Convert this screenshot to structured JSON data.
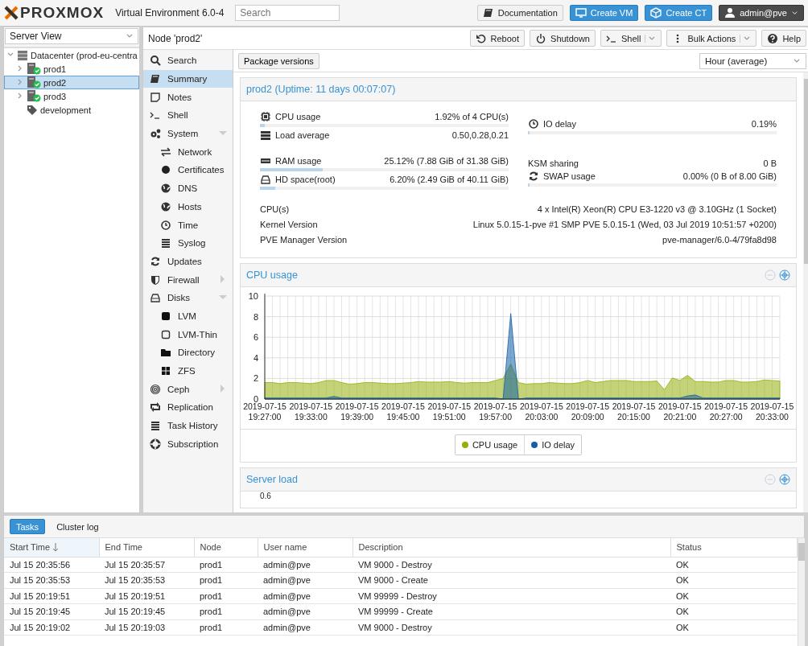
{
  "header": {
    "brand": "PROXMOX",
    "product": "Virtual Environment 6.0-4",
    "search": {
      "placeholder": "Search"
    },
    "buttons": [
      {
        "label": "Documentation",
        "kind": "plain"
      },
      {
        "label": "Create VM",
        "kind": "primary"
      },
      {
        "label": "Create CT",
        "kind": "primary"
      },
      {
        "label": "admin@pve",
        "kind": "user"
      }
    ]
  },
  "tree": {
    "view": "Server View",
    "items": [
      {
        "label": "Datacenter (prod-eu-centra",
        "kind": "datacenter",
        "expanded": true,
        "selected": false,
        "children": [
          {
            "label": "prod1",
            "kind": "node",
            "expanded": false,
            "selected": false
          },
          {
            "label": "prod2",
            "kind": "node",
            "expanded": false,
            "selected": true
          },
          {
            "label": "prod3",
            "kind": "node",
            "expanded": false,
            "selected": false
          },
          {
            "label": "development",
            "kind": "pool",
            "selected": false
          }
        ]
      }
    ]
  },
  "node_bar": {
    "title": "Node 'prod2'",
    "buttons": [
      {
        "label": "Reboot",
        "menu": false
      },
      {
        "label": "Shutdown",
        "menu": false
      },
      {
        "label": "Shell",
        "menu": true
      },
      {
        "label": "Bulk Actions",
        "menu": true
      },
      {
        "label": "Help",
        "menu": false
      }
    ]
  },
  "nav": [
    {
      "label": "Search",
      "selected": false
    },
    {
      "label": "Summary",
      "selected": true
    },
    {
      "label": "Notes",
      "selected": false
    },
    {
      "label": "Shell",
      "selected": false
    },
    {
      "label": "System",
      "selected": false,
      "expanded": true,
      "children": [
        {
          "label": "Network",
          "selected": false
        },
        {
          "label": "Certificates",
          "selected": false
        },
        {
          "label": "DNS",
          "selected": false
        },
        {
          "label": "Hosts",
          "selected": false
        },
        {
          "label": "Time",
          "selected": false
        },
        {
          "label": "Syslog",
          "selected": false
        }
      ]
    },
    {
      "label": "Updates",
      "selected": false
    },
    {
      "label": "Firewall",
      "selected": false,
      "expanded": false
    },
    {
      "label": "Disks",
      "selected": false,
      "expanded": true,
      "children": [
        {
          "label": "LVM",
          "selected": false
        },
        {
          "label": "LVM-Thin",
          "selected": false
        },
        {
          "label": "Directory",
          "selected": false
        },
        {
          "label": "ZFS",
          "selected": false
        }
      ]
    },
    {
      "label": "Ceph",
      "selected": false,
      "expanded": false
    },
    {
      "label": "Replication",
      "selected": false
    },
    {
      "label": "Task History",
      "selected": false
    },
    {
      "label": "Subscription",
      "selected": false
    }
  ],
  "toolbar": {
    "button": "Package versions",
    "timeframe": "Hour (average)"
  },
  "summary": {
    "title": "prod2 (Uptime: 11 days 00:07:07)",
    "groups": [
      {
        "left": [
          {
            "kind": "meter",
            "label": "CPU usage",
            "value": "1.92% of 4 CPU(s)",
            "level": 0.0192
          },
          {
            "kind": "text",
            "label": "Load average",
            "value": "0.50,0.28,0.21"
          }
        ],
        "right": [
          {
            "kind": "meter",
            "label": "IO delay",
            "value": "0.19%",
            "level": 0.0019
          }
        ]
      },
      {
        "left": [
          {
            "kind": "meter",
            "label": "RAM usage",
            "value": "25.12% (7.88 GiB of 31.38 GiB)",
            "level": 0.2512
          },
          {
            "kind": "meter",
            "label": "HD space(root)",
            "value": "6.20% (2.49 GiB of 40.11 GiB)",
            "level": 0.062
          }
        ],
        "right": [
          {
            "kind": "text",
            "label": "KSM sharing",
            "value": "0 B"
          },
          {
            "kind": "meter",
            "label": "SWAP usage",
            "value": "0.00% (0 B of 8.00 GiB)",
            "level": 0
          }
        ]
      }
    ],
    "info": [
      {
        "label": "CPU(s)",
        "value": "4 x Intel(R) Xeon(R) CPU E3-1220 v3 @ 3.10GHz (1 Socket)"
      },
      {
        "label": "Kernel Version",
        "value": "Linux 5.0.15-1-pve #1 SMP PVE 5.0.15-1 (Wed, 03 Jul 2019 10:51:57 +0200)"
      },
      {
        "label": "PVE Manager Version",
        "value": "pve-manager/6.0-4/79fa8d98"
      }
    ]
  },
  "cpu_panel": {
    "title": "CPU usage",
    "chart_data": {
      "type": "area",
      "categories": [
        "2019-07-15 19:27:00",
        null,
        null,
        null,
        null,
        null,
        "2019-07-15 19:33:00",
        null,
        null,
        null,
        null,
        null,
        "2019-07-15 19:39:00",
        null,
        null,
        null,
        null,
        null,
        "2019-07-15 19:45:00",
        null,
        null,
        null,
        null,
        null,
        "2019-07-15 19:51:00",
        null,
        null,
        null,
        null,
        null,
        "2019-07-15 19:57:00",
        null,
        null,
        null,
        null,
        null,
        "2019-07-15 20:03:00",
        null,
        null,
        null,
        null,
        null,
        "2019-07-15 20:09:00",
        null,
        null,
        null,
        null,
        null,
        "2019-07-15 20:15:00",
        null,
        null,
        null,
        null,
        null,
        "2019-07-15 20:21:00",
        null,
        null,
        null,
        null,
        null,
        "2019-07-15 20:27:00",
        null,
        null,
        null,
        null,
        null,
        "2019-07-15 20:33:00",
        null
      ],
      "ylim": [
        0,
        10
      ],
      "yticks": [
        0,
        2,
        4,
        6,
        8,
        10
      ],
      "grid": true,
      "series": [
        {
          "name": "CPU usage",
          "color": "#94ae0a",
          "values": [
            1.6,
            1.6,
            1.5,
            1.6,
            1.6,
            1.55,
            1.5,
            1.6,
            1.8,
            1.8,
            1.6,
            1.45,
            1.5,
            1.6,
            1.6,
            1.55,
            1.5,
            1.5,
            1.55,
            1.6,
            1.7,
            1.65,
            1.65,
            1.65,
            1.7,
            1.6,
            1.55,
            1.6,
            1.6,
            1.6,
            1.8,
            2.0,
            3.4,
            1.6,
            1.45,
            1.5,
            1.5,
            1.6,
            1.55,
            1.5,
            1.5,
            1.6,
            1.8,
            1.6,
            1.7,
            1.8,
            1.8,
            1.8,
            1.7,
            1.7,
            1.7,
            1.75,
            0.9,
            2.05,
            1.8,
            2.3,
            1.7,
            1.7,
            1.65,
            1.65,
            1.8,
            1.8,
            1.65,
            1.65,
            1.7,
            1.85,
            1.8,
            1.75
          ]
        },
        {
          "name": "IO delay",
          "color": "#115fa6",
          "values": [
            0.1,
            0.1,
            0.1,
            0.1,
            0.1,
            0.1,
            0.1,
            0.1,
            0.1,
            0.25,
            0.1,
            0.1,
            0.1,
            0.1,
            0.1,
            0.1,
            0.1,
            0.1,
            0.1,
            0.1,
            0.1,
            0.1,
            0.1,
            0.1,
            0.1,
            0.1,
            0.1,
            0.1,
            0.1,
            0.1,
            0.1,
            0,
            8.3,
            0,
            0.1,
            0.1,
            0.1,
            0.1,
            0.1,
            0.1,
            0.1,
            0.1,
            0.1,
            0.1,
            0.1,
            0.1,
            0.1,
            0.1,
            0.1,
            0.1,
            0.1,
            0.1,
            0.1,
            0.1,
            0.1,
            0.3,
            0.4,
            0.1,
            0.1,
            0.1,
            0.1,
            0.1,
            0.1,
            0.1,
            0.1,
            0.1,
            0.1,
            0.1
          ]
        }
      ]
    }
  },
  "load_panel": {
    "title": "Server load",
    "visible_tick": "0.6"
  },
  "tasks": {
    "tabs": [
      {
        "label": "Tasks",
        "selected": true
      },
      {
        "label": "Cluster log",
        "selected": false
      }
    ],
    "columns": [
      {
        "label": "Start Time",
        "sorted": true
      },
      {
        "label": "End Time",
        "sorted": false
      },
      {
        "label": "Node",
        "sorted": false
      },
      {
        "label": "User name",
        "sorted": false
      },
      {
        "label": "Description",
        "sorted": false
      },
      {
        "label": "Status",
        "sorted": false
      }
    ],
    "rows": [
      [
        "Jul 15 20:35:56",
        "Jul 15 20:35:57",
        "prod1",
        "admin@pve",
        "VM 9000 - Destroy",
        "OK"
      ],
      [
        "Jul 15 20:35:53",
        "Jul 15 20:35:53",
        "prod1",
        "admin@pve",
        "VM 9000 - Create",
        "OK"
      ],
      [
        "Jul 15 20:19:51",
        "Jul 15 20:19:51",
        "prod1",
        "admin@pve",
        "VM 99999 - Destroy",
        "OK"
      ],
      [
        "Jul 15 20:19:45",
        "Jul 15 20:19:45",
        "prod1",
        "admin@pve",
        "VM 99999 - Create",
        "OK"
      ],
      [
        "Jul 15 20:19:02",
        "Jul 15 20:19:03",
        "prod1",
        "admin@pve",
        "VM 9000 - Destroy",
        "OK"
      ]
    ]
  }
}
